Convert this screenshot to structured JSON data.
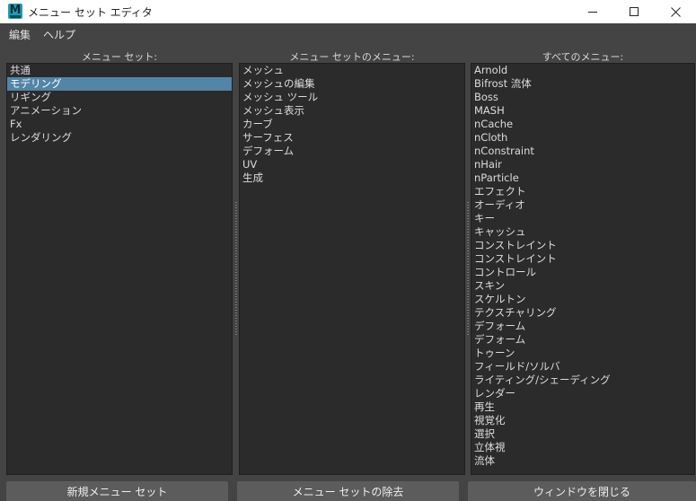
{
  "window": {
    "title": "メニュー セット エディタ",
    "app_icon_letter": "M",
    "app_icon_color": "#1a9fb5"
  },
  "menubar": {
    "edit_label": "編集",
    "help_label": "ヘルプ"
  },
  "menu_sets": {
    "header": "メニュー セット:",
    "items": [
      "共通",
      "モデリング",
      "リギング",
      "アニメーション",
      "Fx",
      "レンダリング"
    ],
    "selected_index": 1
  },
  "set_menus": {
    "header": "メニュー セットのメニュー:",
    "items": [
      "メッシュ",
      "メッシュの編集",
      "メッシュ ツール",
      "メッシュ表示",
      "カーブ",
      "サーフェス",
      "デフォーム",
      "UV",
      "生成"
    ]
  },
  "all_menus": {
    "header": "すべてのメニュー:",
    "items": [
      "Arnold",
      "Bifrost 流体",
      "Boss",
      "MASH",
      "nCache",
      "nCloth",
      "nConstraint",
      "nHair",
      "nParticle",
      "エフェクト",
      "オーディオ",
      "キー",
      "キャッシュ",
      "コンストレイント",
      "コンストレイント",
      "コントロール",
      "スキン",
      "スケルトン",
      "テクスチャリング",
      "デフォーム",
      "デフォーム",
      "トゥーン",
      "フィールド/ソルバ",
      "ライティング/シェーディング",
      "レンダー",
      "再生",
      "視覚化",
      "選択",
      "立体視",
      "流体"
    ]
  },
  "buttons": {
    "new_set": "新規メニュー セット",
    "remove_set": "メニュー セットの除去",
    "close_window": "ウィンドウを閉じる"
  },
  "colors": {
    "selection": "#5285a6",
    "list_background": "#2b2b2b",
    "panel_background": "#444444"
  }
}
